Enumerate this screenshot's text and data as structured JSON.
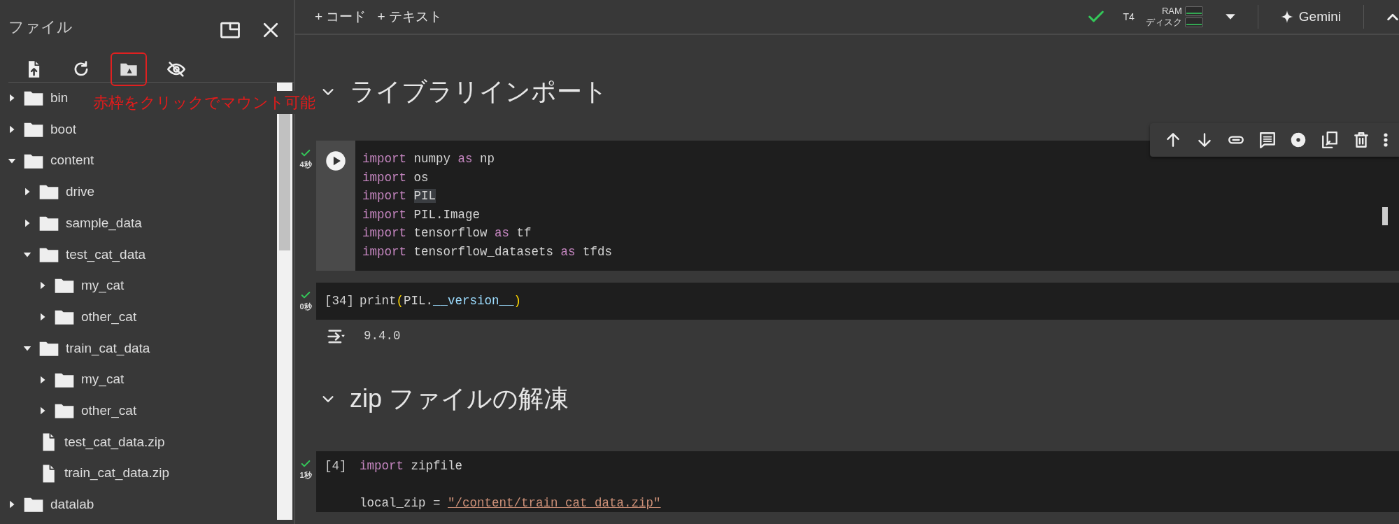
{
  "file_panel": {
    "title": "ファイル",
    "toolbar": [
      {
        "kind": "upload",
        "highlighted": false
      },
      {
        "kind": "refresh",
        "highlighted": false
      },
      {
        "kind": "drive",
        "highlighted": true
      },
      {
        "kind": "hide",
        "highlighted": false
      }
    ],
    "annotation": "赤枠をクリックでマウント可能",
    "tree": [
      {
        "label": "bin",
        "kind": "folder",
        "expanded": false
      },
      {
        "label": "boot",
        "kind": "folder",
        "expanded": false
      },
      {
        "label": "content",
        "kind": "folder",
        "expanded": true,
        "children": [
          {
            "label": "drive",
            "kind": "folder",
            "expanded": false
          },
          {
            "label": "sample_data",
            "kind": "folder",
            "expanded": false
          },
          {
            "label": "test_cat_data",
            "kind": "folder",
            "expanded": true,
            "children": [
              {
                "label": "my_cat",
                "kind": "folder",
                "expanded": false
              },
              {
                "label": "other_cat",
                "kind": "folder",
                "expanded": false
              }
            ]
          },
          {
            "label": "train_cat_data",
            "kind": "folder",
            "expanded": true,
            "children": [
              {
                "label": "my_cat",
                "kind": "folder",
                "expanded": false
              },
              {
                "label": "other_cat",
                "kind": "folder",
                "expanded": false
              }
            ]
          },
          {
            "label": "test_cat_data.zip",
            "kind": "file"
          },
          {
            "label": "train_cat_data.zip",
            "kind": "file"
          }
        ]
      },
      {
        "label": "datalab",
        "kind": "folder",
        "expanded": false
      }
    ]
  },
  "top_bar": {
    "add_buttons": [
      "+ コード",
      "+ テキスト"
    ],
    "runtime": "T4",
    "resources": [
      {
        "label": "RAM"
      },
      {
        "label": "ディスク"
      }
    ],
    "gemini": "Gemini"
  },
  "cell_toolbar": [
    {
      "kind": "up"
    },
    {
      "kind": "down"
    },
    {
      "kind": "link"
    },
    {
      "kind": "comment"
    },
    {
      "kind": "settings"
    },
    {
      "kind": "mirror"
    },
    {
      "kind": "delete"
    },
    {
      "kind": "more"
    }
  ],
  "notebook": [
    {
      "kind": "heading",
      "text": "ライブラリインポート",
      "expanded": true
    },
    {
      "kind": "code",
      "time": "4秒",
      "run_button": true,
      "lines": [
        [
          {
            "text": "import",
            "kind": "keyword"
          },
          {
            "text": " numpy ",
            "kind": "plain"
          },
          {
            "text": "as",
            "kind": "keyword"
          },
          {
            "text": " np",
            "kind": "plain"
          }
        ],
        [
          {
            "text": "import",
            "kind": "keyword"
          },
          {
            "text": " os",
            "kind": "plain"
          }
        ],
        [
          {
            "text": "import ",
            "kind": "keyword"
          },
          {
            "text": "PIL",
            "kind": "match"
          }
        ],
        [
          {
            "text": "import",
            "kind": "keyword"
          },
          {
            "text": " PIL.Image",
            "kind": "plain"
          }
        ],
        [
          {
            "text": "import",
            "kind": "keyword"
          },
          {
            "text": " tensorflow ",
            "kind": "plain"
          },
          {
            "text": "as",
            "kind": "keyword"
          },
          {
            "text": " tf",
            "kind": "plain"
          }
        ],
        [
          {
            "text": "import",
            "kind": "keyword"
          },
          {
            "text": " tensorflow_datasets ",
            "kind": "plain"
          },
          {
            "text": "as",
            "kind": "keyword"
          },
          {
            "text": " tfds",
            "kind": "plain"
          }
        ]
      ]
    },
    {
      "kind": "code",
      "time": "0秒",
      "count": "[34]",
      "lines": [
        [
          {
            "text": "print",
            "kind": "plain"
          },
          {
            "text": "(",
            "kind": "paren"
          },
          {
            "text": "PIL.",
            "kind": "plain"
          },
          {
            "text": "__version__",
            "kind": "attr"
          },
          {
            "text": ")",
            "kind": "paren"
          }
        ]
      ],
      "output": "9.4.0"
    },
    {
      "kind": "heading",
      "text": "zip ファイルの解凍",
      "expanded": true
    },
    {
      "kind": "code",
      "time": "1秒",
      "count": "[4]",
      "lines": [
        [
          {
            "text": "import",
            "kind": "keyword"
          },
          {
            "text": " zipfile",
            "kind": "plain"
          }
        ],
        [
          {
            "text": "local_zip = ",
            "kind": "plain",
            "blank_before": true
          },
          {
            "text": "\"/content/train_cat_data.zip\"",
            "kind": "string"
          }
        ]
      ]
    }
  ]
}
